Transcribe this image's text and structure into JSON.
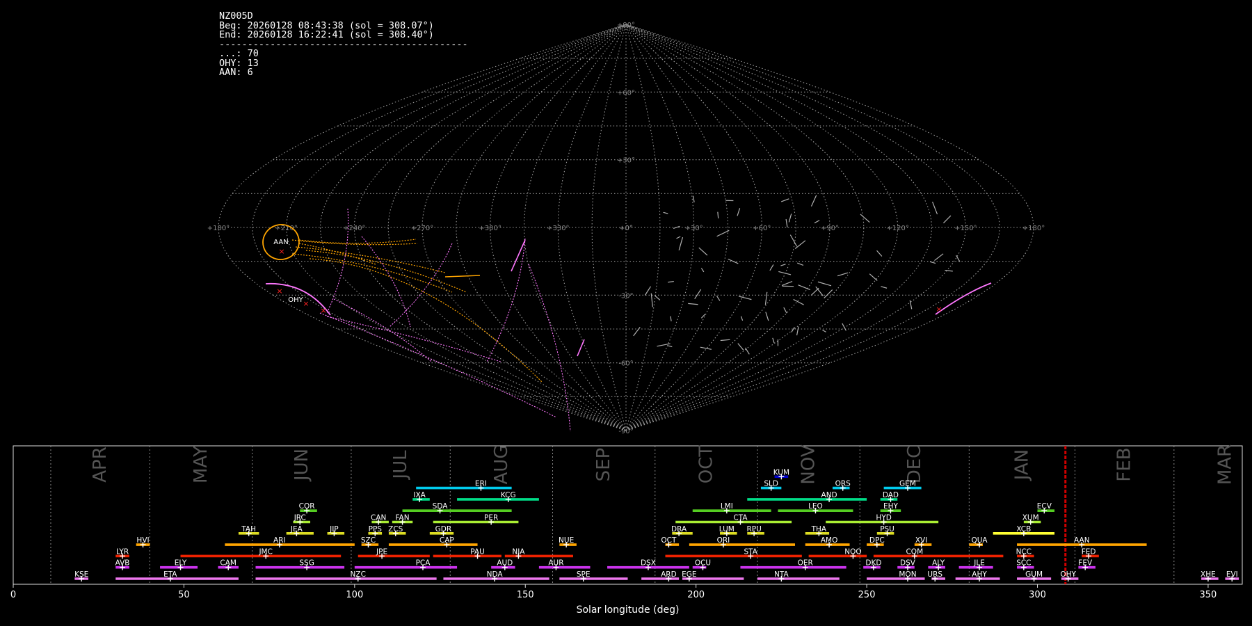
{
  "info": {
    "code": "NZ005D",
    "beg": "Beg: 20260128 08:43:38 (sol = 308.07°)",
    "end": "End: 20260128 16:22:41 (sol = 308.40°)",
    "separator": "--------------------------------------------",
    "counts": [
      "...: 70",
      "OHY: 13",
      "AAN: 6"
    ]
  },
  "colors": {
    "background": "#000000",
    "grid": "#9a9a9a",
    "sporadic": "#b0b0b0",
    "aan": "#ffa500",
    "ohy": "#ff77ff",
    "current": "#d00000"
  },
  "chart_data": [
    {
      "type": "scatter",
      "title": "",
      "projection": "sinusoidal",
      "ra_ticks": [
        "+180°",
        "+150°",
        "+120°",
        "+90°",
        "+60°",
        "+30°",
        "+0°",
        "+330°",
        "+300°",
        "+270°",
        "+240°",
        "+210°",
        "+180°"
      ],
      "dec_ticks": [
        "+90°",
        "+60°",
        "+30°",
        "+0°",
        "-30°",
        "-60°",
        "-90°"
      ],
      "radiants": [
        {
          "name": "AAN",
          "ra": 152,
          "dec": -5,
          "color": "#ffa500"
        },
        {
          "name": "OHY",
          "ra": 150,
          "dec": -37,
          "color": "#ff77ff"
        }
      ],
      "grid": true
    },
    {
      "type": "bar",
      "xlabel": "Solar longitude (deg)",
      "xlim": [
        0,
        360
      ],
      "xticks": [
        0,
        50,
        100,
        150,
        200,
        250,
        300,
        350
      ],
      "current_sol": 308.2,
      "months": [
        {
          "name": "APR",
          "start": 11,
          "end": 40
        },
        {
          "name": "MAY",
          "start": 40,
          "end": 70
        },
        {
          "name": "JUN",
          "start": 70,
          "end": 99
        },
        {
          "name": "JUL",
          "start": 99,
          "end": 128
        },
        {
          "name": "AUG",
          "start": 128,
          "end": 158
        },
        {
          "name": "SEP",
          "start": 158,
          "end": 188
        },
        {
          "name": "OCT",
          "start": 188,
          "end": 218
        },
        {
          "name": "NOV",
          "start": 218,
          "end": 248
        },
        {
          "name": "DEC",
          "start": 248,
          "end": 280
        },
        {
          "name": "JAN",
          "start": 280,
          "end": 311
        },
        {
          "name": "FEB",
          "start": 311,
          "end": 340
        },
        {
          "name": "MAR",
          "start": 340,
          "end": 370
        }
      ],
      "showers": [
        {
          "code": "KUM",
          "start": 223,
          "end": 227,
          "peak": 225,
          "row": 8,
          "color": "#0000cc"
        },
        {
          "code": "ERI",
          "start": 118,
          "end": 146,
          "peak": 137,
          "row": 7,
          "color": "#00ccee"
        },
        {
          "code": "SLD",
          "start": 219,
          "end": 225,
          "peak": 222,
          "row": 7,
          "color": "#00ccee"
        },
        {
          "code": "ORS",
          "start": 240,
          "end": 245,
          "peak": 243,
          "row": 7,
          "color": "#00ccee"
        },
        {
          "code": "GEM",
          "start": 255,
          "end": 266,
          "peak": 262,
          "row": 7,
          "color": "#00ccee"
        },
        {
          "code": "IXA",
          "start": 117,
          "end": 122,
          "peak": 119,
          "row": 6,
          "color": "#00dd88"
        },
        {
          "code": "KCG",
          "start": 130,
          "end": 154,
          "peak": 145,
          "row": 6,
          "color": "#00dd88"
        },
        {
          "code": "AND",
          "start": 215,
          "end": 250,
          "peak": 239,
          "row": 6,
          "color": "#00dd88"
        },
        {
          "code": "DAD",
          "start": 254,
          "end": 259,
          "peak": 257,
          "row": 6,
          "color": "#00dd88"
        },
        {
          "code": "COR",
          "start": 84,
          "end": 89,
          "peak": 86,
          "row": 5,
          "color": "#55cc22"
        },
        {
          "code": "SDA",
          "start": 114,
          "end": 146,
          "peak": 125,
          "row": 5,
          "color": "#55cc22"
        },
        {
          "code": "LMI",
          "start": 199,
          "end": 222,
          "peak": 209,
          "row": 5,
          "color": "#55cc22"
        },
        {
          "code": "LEO",
          "start": 224,
          "end": 246,
          "peak": 235,
          "row": 5,
          "color": "#55cc22"
        },
        {
          "code": "EHY",
          "start": 254,
          "end": 260,
          "peak": 257,
          "row": 5,
          "color": "#55cc22"
        },
        {
          "code": "ECV",
          "start": 300,
          "end": 305,
          "peak": 302,
          "row": 5,
          "color": "#55cc22"
        },
        {
          "code": "JRC",
          "start": 82,
          "end": 87,
          "peak": 84,
          "row": 4,
          "color": "#aaee33"
        },
        {
          "code": "CAN",
          "start": 105,
          "end": 110,
          "peak": 107,
          "row": 4,
          "color": "#aaee33"
        },
        {
          "code": "FAN",
          "start": 111,
          "end": 117,
          "peak": 114,
          "row": 4,
          "color": "#aaee33"
        },
        {
          "code": "PER",
          "start": 123,
          "end": 148,
          "peak": 140,
          "row": 4,
          "color": "#aaee33"
        },
        {
          "code": "CTA",
          "start": 194,
          "end": 228,
          "peak": 213,
          "row": 4,
          "color": "#aaee33"
        },
        {
          "code": "HYD",
          "start": 238,
          "end": 271,
          "peak": 255,
          "row": 4,
          "color": "#aaee33"
        },
        {
          "code": "XUM",
          "start": 296,
          "end": 301,
          "peak": 298,
          "row": 4,
          "color": "#aaee33"
        },
        {
          "code": "TAH",
          "start": 66,
          "end": 72,
          "peak": 69,
          "row": 3,
          "color": "#dddd22"
        },
        {
          "code": "JEA",
          "start": 80,
          "end": 88,
          "peak": 83,
          "row": 3,
          "color": "#dddd22"
        },
        {
          "code": "JIP",
          "start": 92,
          "end": 97,
          "peak": 94,
          "row": 3,
          "color": "#dddd22"
        },
        {
          "code": "PPS",
          "start": 104,
          "end": 108,
          "peak": 106,
          "row": 3,
          "color": "#dddd22"
        },
        {
          "code": "ZCS",
          "start": 110,
          "end": 115,
          "peak": 112,
          "row": 3,
          "color": "#dddd22"
        },
        {
          "code": "GDR",
          "start": 122,
          "end": 129,
          "peak": 126,
          "row": 3,
          "color": "#dddd22"
        },
        {
          "code": "DRA",
          "start": 193,
          "end": 199,
          "peak": 195,
          "row": 3,
          "color": "#dddd22"
        },
        {
          "code": "LUM",
          "start": 207,
          "end": 212,
          "peak": 209,
          "row": 3,
          "color": "#dddd22"
        },
        {
          "code": "RPU",
          "start": 215,
          "end": 220,
          "peak": 217,
          "row": 3,
          "color": "#dddd22"
        },
        {
          "code": "THA",
          "start": 232,
          "end": 239,
          "peak": 236,
          "row": 3,
          "color": "#dddd22"
        },
        {
          "code": "PSU",
          "start": 253,
          "end": 258,
          "peak": 256,
          "row": 3,
          "color": "#dddd22"
        },
        {
          "code": "XCB",
          "start": 287,
          "end": 305,
          "peak": 296,
          "row": 3,
          "color": "#ffff33"
        },
        {
          "code": "HVI",
          "start": 36,
          "end": 40,
          "peak": 38,
          "row": 2,
          "color": "#ffa500"
        },
        {
          "code": "ARI",
          "start": 62,
          "end": 100,
          "peak": 78,
          "row": 2,
          "color": "#ffa500"
        },
        {
          "code": "SZC",
          "start": 102,
          "end": 107,
          "peak": 104,
          "row": 2,
          "color": "#ffa500"
        },
        {
          "code": "CAP",
          "start": 110,
          "end": 136,
          "peak": 127,
          "row": 2,
          "color": "#ffa500"
        },
        {
          "code": "NUE",
          "start": 160,
          "end": 165,
          "peak": 162,
          "row": 2,
          "color": "#ffa500"
        },
        {
          "code": "OCT",
          "start": 191,
          "end": 195,
          "peak": 192,
          "row": 2,
          "color": "#ffa500"
        },
        {
          "code": "ORI",
          "start": 198,
          "end": 229,
          "peak": 208,
          "row": 2,
          "color": "#ffa500"
        },
        {
          "code": "AMO",
          "start": 232,
          "end": 245,
          "peak": 239,
          "row": 2,
          "color": "#ffa500"
        },
        {
          "code": "DPC",
          "start": 250,
          "end": 255,
          "peak": 253,
          "row": 2,
          "color": "#ffa500"
        },
        {
          "code": "XVI",
          "start": 264,
          "end": 269,
          "peak": 266,
          "row": 2,
          "color": "#ffa500"
        },
        {
          "code": "QUA",
          "start": 280,
          "end": 284,
          "peak": 283,
          "row": 2,
          "color": "#ffa500"
        },
        {
          "code": "AAN",
          "start": 294,
          "end": 332,
          "peak": 313,
          "row": 2,
          "color": "#ffa500"
        },
        {
          "code": "LYR",
          "start": 30,
          "end": 34,
          "peak": 32,
          "row": 1,
          "color": "#ee2200"
        },
        {
          "code": "JMC",
          "start": 49,
          "end": 96,
          "peak": 74,
          "row": 1,
          "color": "#ee2200"
        },
        {
          "code": "JPE",
          "start": 101,
          "end": 122,
          "peak": 108,
          "row": 1,
          "color": "#ee2200"
        },
        {
          "code": "PAU",
          "start": 123,
          "end": 143,
          "peak": 136,
          "row": 1,
          "color": "#ee2200"
        },
        {
          "code": "NIA",
          "start": 144,
          "end": 164,
          "peak": 148,
          "row": 1,
          "color": "#ee2200"
        },
        {
          "code": "STA",
          "start": 191,
          "end": 231,
          "peak": 216,
          "row": 1,
          "color": "#ee2200"
        },
        {
          "code": "NOO",
          "start": 233,
          "end": 250,
          "peak": 246,
          "row": 1,
          "color": "#ee2200"
        },
        {
          "code": "COM",
          "start": 252,
          "end": 290,
          "peak": 264,
          "row": 1,
          "color": "#ee2200"
        },
        {
          "code": "NCC",
          "start": 294,
          "end": 299,
          "peak": 296,
          "row": 1,
          "color": "#ee2200"
        },
        {
          "code": "FED",
          "start": 313,
          "end": 318,
          "peak": 315,
          "row": 1,
          "color": "#ee2200"
        },
        {
          "code": "AVB",
          "start": 30,
          "end": 34,
          "peak": 32,
          "row": 0,
          "color": "#cc33ee"
        },
        {
          "code": "ELY",
          "start": 43,
          "end": 54,
          "peak": 49,
          "row": 0,
          "color": "#cc33ee"
        },
        {
          "code": "CAM",
          "start": 60,
          "end": 66,
          "peak": 63,
          "row": 0,
          "color": "#cc33ee"
        },
        {
          "code": "SSG",
          "start": 71,
          "end": 97,
          "peak": 86,
          "row": 0,
          "color": "#cc33ee"
        },
        {
          "code": "PCA",
          "start": 100,
          "end": 130,
          "peak": 120,
          "row": 0,
          "color": "#cc33ee"
        },
        {
          "code": "AUD",
          "start": 140,
          "end": 147,
          "peak": 144,
          "row": 0,
          "color": "#cc33ee"
        },
        {
          "code": "AUR",
          "start": 154,
          "end": 169,
          "peak": 159,
          "row": 0,
          "color": "#cc33ee"
        },
        {
          "code": "DSX",
          "start": 174,
          "end": 198,
          "peak": 186,
          "row": 0,
          "color": "#cc33ee"
        },
        {
          "code": "OCU",
          "start": 199,
          "end": 203,
          "peak": 202,
          "row": 0,
          "color": "#cc33ee"
        },
        {
          "code": "OER",
          "start": 213,
          "end": 244,
          "peak": 232,
          "row": 0,
          "color": "#cc33ee"
        },
        {
          "code": "DKD",
          "start": 249,
          "end": 254,
          "peak": 252,
          "row": 0,
          "color": "#cc33ee"
        },
        {
          "code": "DSV",
          "start": 259,
          "end": 264,
          "peak": 262,
          "row": 0,
          "color": "#cc33ee"
        },
        {
          "code": "ALY",
          "start": 268,
          "end": 273,
          "peak": 271,
          "row": 0,
          "color": "#cc33ee"
        },
        {
          "code": "JLE",
          "start": 277,
          "end": 287,
          "peak": 283,
          "row": 0,
          "color": "#cc33ee"
        },
        {
          "code": "SCC",
          "start": 294,
          "end": 299,
          "peak": 296,
          "row": 0,
          "color": "#cc33ee"
        },
        {
          "code": "FEV",
          "start": 312,
          "end": 317,
          "peak": 314,
          "row": 0,
          "color": "#cc33ee"
        },
        {
          "code": "KSE",
          "start": 18,
          "end": 22,
          "peak": 20,
          "row": -1,
          "color": "#ee77ee"
        },
        {
          "code": "ETA",
          "start": 30,
          "end": 66,
          "peak": 46,
          "row": -1,
          "color": "#ee77ee"
        },
        {
          "code": "NZC",
          "start": 71,
          "end": 124,
          "peak": 101,
          "row": -1,
          "color": "#ee77ee"
        },
        {
          "code": "NDA",
          "start": 126,
          "end": 157,
          "peak": 141,
          "row": -1,
          "color": "#ee77ee"
        },
        {
          "code": "SPE",
          "start": 160,
          "end": 180,
          "peak": 167,
          "row": -1,
          "color": "#ee77ee"
        },
        {
          "code": "ARD",
          "start": 184,
          "end": 195,
          "peak": 192,
          "row": -1,
          "color": "#ee77ee"
        },
        {
          "code": "EGE",
          "start": 196,
          "end": 214,
          "peak": 198,
          "row": -1,
          "color": "#ee77ee"
        },
        {
          "code": "NTA",
          "start": 218,
          "end": 242,
          "peak": 225,
          "row": -1,
          "color": "#ee77ee"
        },
        {
          "code": "MON",
          "start": 250,
          "end": 267,
          "peak": 262,
          "row": -1,
          "color": "#ee77ee"
        },
        {
          "code": "URS",
          "start": 269,
          "end": 273,
          "peak": 270,
          "row": -1,
          "color": "#ee77ee"
        },
        {
          "code": "AHY",
          "start": 276,
          "end": 289,
          "peak": 283,
          "row": -1,
          "color": "#ee77ee"
        },
        {
          "code": "GUM",
          "start": 294,
          "end": 304,
          "peak": 299,
          "row": -1,
          "color": "#ee77ee"
        },
        {
          "code": "OHY",
          "start": 307,
          "end": 312,
          "peak": 309,
          "row": -1,
          "color": "#ee77ee"
        },
        {
          "code": "XHE",
          "start": 348,
          "end": 353,
          "peak": 350,
          "row": -1,
          "color": "#ee77ee"
        },
        {
          "code": "EVI",
          "start": 355,
          "end": 359,
          "peak": 357,
          "row": -1,
          "color": "#ee77ee"
        }
      ]
    }
  ]
}
